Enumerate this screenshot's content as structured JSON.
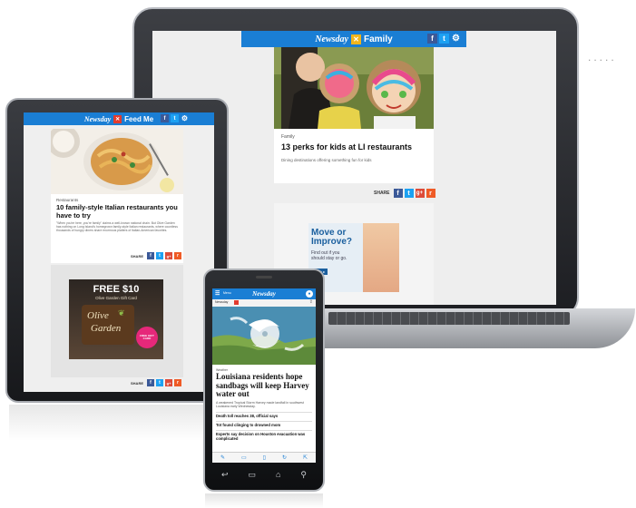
{
  "laptop": {
    "brand": "Newsday",
    "section": "Family",
    "article_kicker": "Family",
    "article_title": "13 perks for kids at LI restaurants",
    "article_summary": "Dining destinations offering something fun for kids",
    "share_label": "SHARE",
    "ad": {
      "line1": "Move or",
      "line2": "Improve?",
      "line3": "Find out if you",
      "line4": "should stay or go.",
      "cta": "More ▸"
    }
  },
  "tablet": {
    "brand": "Newsday",
    "section": "Feed Me",
    "article_kicker": "Restaurants",
    "article_title": "10 family-style Italian restaurants you have to try",
    "article_summary": "\"When you're here, you're family\" claims a well-known national chain. But Olive Garden has nothing on Long Island's homegrown family-style Italian restaurants, where countless thousands of hungry diners share enormous platters of Italian-American favorites.",
    "share_label": "SHARE",
    "ad": {
      "headline": "FREE $10",
      "subline": "Olive Garden Gift Card",
      "logo_line1": "Olive",
      "logo_line2": "Garden",
      "badge": "FREE GIFT CARD"
    }
  },
  "phone": {
    "menu_label": "Menu",
    "brand": "Newsday",
    "sub_label": "Newsday",
    "kicker": "Weather",
    "headline": "Louisiana residents hope sandbags will keep Harvey water out",
    "summary": "A weakened Tropical Storm Harvey made landfall in southwest Louisiana early Wednesday.",
    "links": [
      "Death toll reaches 38, official says",
      "Tot found clinging to drowned mom",
      "Experts say decision on Houston evacuation was complicated"
    ]
  },
  "social_icons": {
    "facebook": "f",
    "twitter": "t",
    "googleplus": "g+",
    "reddit": "r",
    "gear": "⚙"
  },
  "colors": {
    "brand_blue": "#1a7ed4",
    "family_badge": "#f2b51b",
    "feedme_badge": "#e23b2e",
    "ad_blue": "#1a5f9e"
  }
}
